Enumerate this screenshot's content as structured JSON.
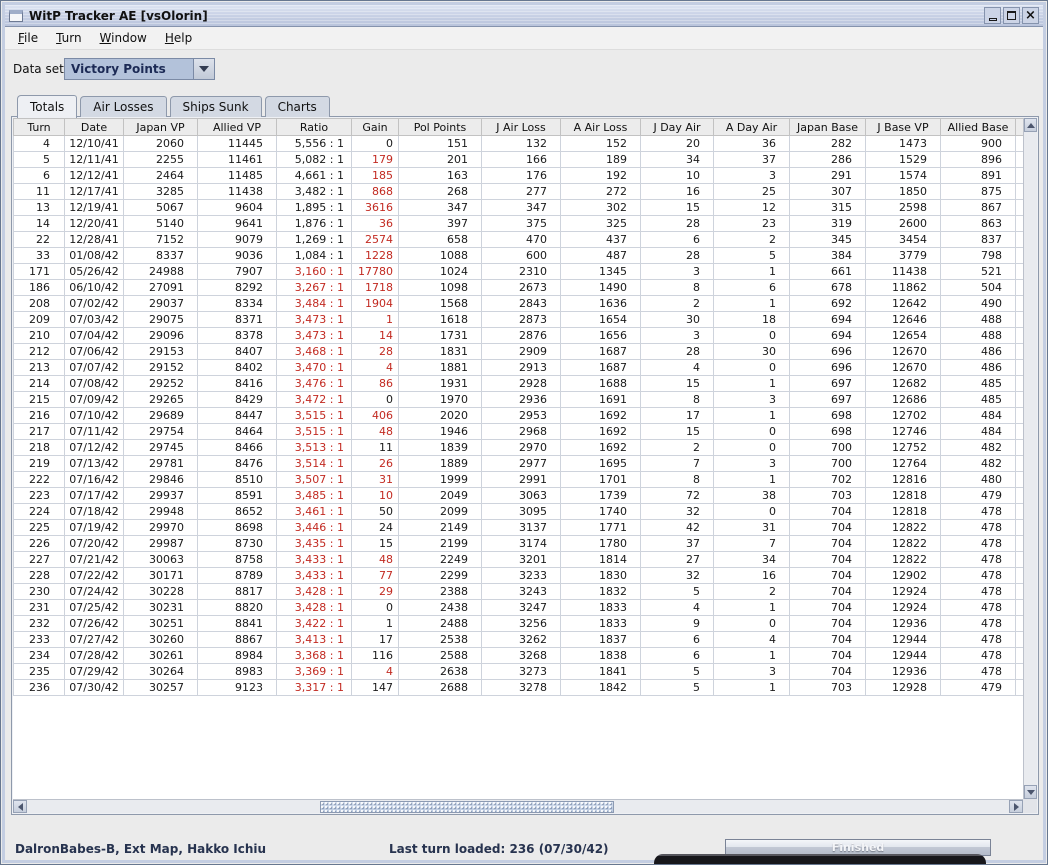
{
  "window": {
    "title": "WitP Tracker AE [vsOlorin]"
  },
  "menu": [
    {
      "label": "File"
    },
    {
      "label": "Turn"
    },
    {
      "label": "Window"
    },
    {
      "label": "Help"
    }
  ],
  "dataset": {
    "label": "Data set:",
    "value": "Victory Points"
  },
  "tabs": [
    {
      "label": "Totals",
      "selected": true
    },
    {
      "label": "Air Losses",
      "selected": false
    },
    {
      "label": "Ships Sunk",
      "selected": false
    },
    {
      "label": "Charts",
      "selected": false
    }
  ],
  "colors": {
    "negative_value": "#c22a21",
    "status_text": "#27334f",
    "combo_selection_bg": "#b3c2da"
  },
  "table": {
    "columns": [
      "Turn",
      "Date",
      "Japan VP",
      "Allied VP",
      "Ratio",
      "Gain",
      "Pol Points",
      "J Air Loss",
      "A Air Loss",
      "J Day Air",
      "A Day Air",
      "Japan Base",
      "J Base VP",
      "Allied Base",
      "A"
    ],
    "rows": [
      {
        "c": [
          "4",
          "12/10/41",
          "2060",
          "11445",
          "5,556 : 1",
          "0",
          "151",
          "132",
          "152",
          "20",
          "36",
          "282",
          "1473",
          "900",
          ""
        ],
        "rr": false,
        "gr": false
      },
      {
        "c": [
          "5",
          "12/11/41",
          "2255",
          "11461",
          "5,082 : 1",
          "179",
          "201",
          "166",
          "189",
          "34",
          "37",
          "286",
          "1529",
          "896",
          ""
        ],
        "rr": false,
        "gr": true
      },
      {
        "c": [
          "6",
          "12/12/41",
          "2464",
          "11485",
          "4,661 : 1",
          "185",
          "163",
          "176",
          "192",
          "10",
          "3",
          "291",
          "1574",
          "891",
          ""
        ],
        "rr": false,
        "gr": true
      },
      {
        "c": [
          "11",
          "12/17/41",
          "3285",
          "11438",
          "3,482 : 1",
          "868",
          "268",
          "277",
          "272",
          "16",
          "25",
          "307",
          "1850",
          "875",
          ""
        ],
        "rr": false,
        "gr": true
      },
      {
        "c": [
          "13",
          "12/19/41",
          "5067",
          "9604",
          "1,895 : 1",
          "3616",
          "347",
          "347",
          "302",
          "15",
          "12",
          "315",
          "2598",
          "867",
          ""
        ],
        "rr": false,
        "gr": true
      },
      {
        "c": [
          "14",
          "12/20/41",
          "5140",
          "9641",
          "1,876 : 1",
          "36",
          "397",
          "375",
          "325",
          "28",
          "23",
          "319",
          "2600",
          "863",
          ""
        ],
        "rr": false,
        "gr": true
      },
      {
        "c": [
          "22",
          "12/28/41",
          "7152",
          "9079",
          "1,269 : 1",
          "2574",
          "658",
          "470",
          "437",
          "6",
          "2",
          "345",
          "3454",
          "837",
          ""
        ],
        "rr": false,
        "gr": true
      },
      {
        "c": [
          "33",
          "01/08/42",
          "8337",
          "9036",
          "1,084 : 1",
          "1228",
          "1088",
          "600",
          "487",
          "28",
          "5",
          "384",
          "3779",
          "798",
          ""
        ],
        "rr": false,
        "gr": true
      },
      {
        "c": [
          "171",
          "05/26/42",
          "24988",
          "7907",
          "3,160 : 1",
          "17780",
          "1024",
          "2310",
          "1345",
          "3",
          "1",
          "661",
          "11438",
          "521",
          ""
        ],
        "rr": true,
        "gr": true
      },
      {
        "c": [
          "186",
          "06/10/42",
          "27091",
          "8292",
          "3,267 : 1",
          "1718",
          "1098",
          "2673",
          "1490",
          "8",
          "6",
          "678",
          "11862",
          "504",
          ""
        ],
        "rr": true,
        "gr": true
      },
      {
        "c": [
          "208",
          "07/02/42",
          "29037",
          "8334",
          "3,484 : 1",
          "1904",
          "1568",
          "2843",
          "1636",
          "2",
          "1",
          "692",
          "12642",
          "490",
          ""
        ],
        "rr": true,
        "gr": true
      },
      {
        "c": [
          "209",
          "07/03/42",
          "29075",
          "8371",
          "3,473 : 1",
          "1",
          "1618",
          "2873",
          "1654",
          "30",
          "18",
          "694",
          "12646",
          "488",
          ""
        ],
        "rr": true,
        "gr": true
      },
      {
        "c": [
          "210",
          "07/04/42",
          "29096",
          "8378",
          "3,473 : 1",
          "14",
          "1731",
          "2876",
          "1656",
          "3",
          "0",
          "694",
          "12654",
          "488",
          ""
        ],
        "rr": true,
        "gr": true
      },
      {
        "c": [
          "212",
          "07/06/42",
          "29153",
          "8407",
          "3,468 : 1",
          "28",
          "1831",
          "2909",
          "1687",
          "28",
          "30",
          "696",
          "12670",
          "486",
          ""
        ],
        "rr": true,
        "gr": true
      },
      {
        "c": [
          "213",
          "07/07/42",
          "29152",
          "8402",
          "3,470 : 1",
          "4",
          "1881",
          "2913",
          "1687",
          "4",
          "0",
          "696",
          "12670",
          "486",
          ""
        ],
        "rr": true,
        "gr": true
      },
      {
        "c": [
          "214",
          "07/08/42",
          "29252",
          "8416",
          "3,476 : 1",
          "86",
          "1931",
          "2928",
          "1688",
          "15",
          "1",
          "697",
          "12682",
          "485",
          ""
        ],
        "rr": true,
        "gr": true
      },
      {
        "c": [
          "215",
          "07/09/42",
          "29265",
          "8429",
          "3,472 : 1",
          "0",
          "1970",
          "2936",
          "1691",
          "8",
          "3",
          "697",
          "12686",
          "485",
          ""
        ],
        "rr": true,
        "gr": false
      },
      {
        "c": [
          "216",
          "07/10/42",
          "29689",
          "8447",
          "3,515 : 1",
          "406",
          "2020",
          "2953",
          "1692",
          "17",
          "1",
          "698",
          "12702",
          "484",
          ""
        ],
        "rr": true,
        "gr": true
      },
      {
        "c": [
          "217",
          "07/11/42",
          "29754",
          "8464",
          "3,515 : 1",
          "48",
          "1946",
          "2968",
          "1692",
          "15",
          "0",
          "698",
          "12746",
          "484",
          ""
        ],
        "rr": true,
        "gr": true
      },
      {
        "c": [
          "218",
          "07/12/42",
          "29745",
          "8466",
          "3,513 : 1",
          "11",
          "1839",
          "2970",
          "1692",
          "2",
          "0",
          "700",
          "12752",
          "482",
          ""
        ],
        "rr": true,
        "gr": false
      },
      {
        "c": [
          "219",
          "07/13/42",
          "29781",
          "8476",
          "3,514 : 1",
          "26",
          "1889",
          "2977",
          "1695",
          "7",
          "3",
          "700",
          "12764",
          "482",
          ""
        ],
        "rr": true,
        "gr": true
      },
      {
        "c": [
          "222",
          "07/16/42",
          "29846",
          "8510",
          "3,507 : 1",
          "31",
          "1999",
          "2991",
          "1701",
          "8",
          "1",
          "702",
          "12816",
          "480",
          ""
        ],
        "rr": true,
        "gr": true
      },
      {
        "c": [
          "223",
          "07/17/42",
          "29937",
          "8591",
          "3,485 : 1",
          "10",
          "2049",
          "3063",
          "1739",
          "72",
          "38",
          "703",
          "12818",
          "479",
          ""
        ],
        "rr": true,
        "gr": true
      },
      {
        "c": [
          "224",
          "07/18/42",
          "29948",
          "8652",
          "3,461 : 1",
          "50",
          "2099",
          "3095",
          "1740",
          "32",
          "0",
          "704",
          "12818",
          "478",
          ""
        ],
        "rr": true,
        "gr": false
      },
      {
        "c": [
          "225",
          "07/19/42",
          "29970",
          "8698",
          "3,446 : 1",
          "24",
          "2149",
          "3137",
          "1771",
          "42",
          "31",
          "704",
          "12822",
          "478",
          ""
        ],
        "rr": true,
        "gr": false
      },
      {
        "c": [
          "226",
          "07/20/42",
          "29987",
          "8730",
          "3,435 : 1",
          "15",
          "2199",
          "3174",
          "1780",
          "37",
          "7",
          "704",
          "12822",
          "478",
          ""
        ],
        "rr": true,
        "gr": false
      },
      {
        "c": [
          "227",
          "07/21/42",
          "30063",
          "8758",
          "3,433 : 1",
          "48",
          "2249",
          "3201",
          "1814",
          "27",
          "34",
          "704",
          "12822",
          "478",
          ""
        ],
        "rr": true,
        "gr": true
      },
      {
        "c": [
          "228",
          "07/22/42",
          "30171",
          "8789",
          "3,433 : 1",
          "77",
          "2299",
          "3233",
          "1830",
          "32",
          "16",
          "704",
          "12902",
          "478",
          ""
        ],
        "rr": true,
        "gr": true
      },
      {
        "c": [
          "230",
          "07/24/42",
          "30228",
          "8817",
          "3,428 : 1",
          "29",
          "2388",
          "3243",
          "1832",
          "5",
          "2",
          "704",
          "12924",
          "478",
          ""
        ],
        "rr": true,
        "gr": true
      },
      {
        "c": [
          "231",
          "07/25/42",
          "30231",
          "8820",
          "3,428 : 1",
          "0",
          "2438",
          "3247",
          "1833",
          "4",
          "1",
          "704",
          "12924",
          "478",
          ""
        ],
        "rr": true,
        "gr": false
      },
      {
        "c": [
          "232",
          "07/26/42",
          "30251",
          "8841",
          "3,422 : 1",
          "1",
          "2488",
          "3256",
          "1833",
          "9",
          "0",
          "704",
          "12936",
          "478",
          ""
        ],
        "rr": true,
        "gr": false
      },
      {
        "c": [
          "233",
          "07/27/42",
          "30260",
          "8867",
          "3,413 : 1",
          "17",
          "2538",
          "3262",
          "1837",
          "6",
          "4",
          "704",
          "12944",
          "478",
          ""
        ],
        "rr": true,
        "gr": false
      },
      {
        "c": [
          "234",
          "07/28/42",
          "30261",
          "8984",
          "3,368 : 1",
          "116",
          "2588",
          "3268",
          "1838",
          "6",
          "1",
          "704",
          "12944",
          "478",
          ""
        ],
        "rr": true,
        "gr": false
      },
      {
        "c": [
          "235",
          "07/29/42",
          "30264",
          "8983",
          "3,369 : 1",
          "4",
          "2638",
          "3273",
          "1841",
          "5",
          "3",
          "704",
          "12936",
          "478",
          ""
        ],
        "rr": true,
        "gr": true
      },
      {
        "c": [
          "236",
          "07/30/42",
          "30257",
          "9123",
          "3,317 : 1",
          "147",
          "2688",
          "3278",
          "1842",
          "5",
          "1",
          "703",
          "12928",
          "479",
          ""
        ],
        "rr": true,
        "gr": false
      }
    ]
  },
  "statusbar": {
    "left": "DalronBabes-B, Ext Map, Hakko Ichiu",
    "center": "Last turn loaded: 236 (07/30/42)",
    "progress": "Finished"
  }
}
